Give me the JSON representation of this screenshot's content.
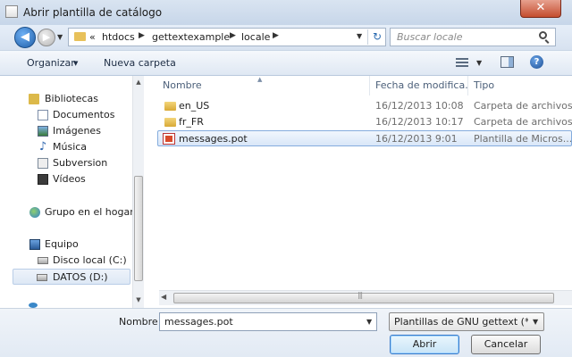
{
  "window": {
    "title": "Abrir plantilla de catálogo"
  },
  "navigation": {
    "back_glyph": "◀",
    "forward_glyph": "▶",
    "breadcrumb": [
      "htdocs",
      "gettextexample",
      "locale"
    ],
    "overflow": "«",
    "search_placeholder": "Buscar locale"
  },
  "toolbar": {
    "organize_label": "Organizar",
    "new_folder_label": "Nueva carpeta",
    "help_label": "?"
  },
  "sidebar": {
    "items": [
      {
        "label": "Bibliotecas",
        "icon": "library-icon"
      },
      {
        "label": "Documentos",
        "icon": "documents-icon"
      },
      {
        "label": "Imágenes",
        "icon": "pictures-icon"
      },
      {
        "label": "Música",
        "icon": "music-icon"
      },
      {
        "label": "Subversion",
        "icon": "subversion-icon"
      },
      {
        "label": "Vídeos",
        "icon": "videos-icon"
      },
      {
        "label": "Grupo en el hogar",
        "icon": "homegroup-icon"
      },
      {
        "label": "Equipo",
        "icon": "computer-icon"
      },
      {
        "label": "Disco local (C:)",
        "icon": "local-disk-icon"
      },
      {
        "label": "DATOS (D:)",
        "icon": "drive-icon"
      }
    ]
  },
  "file_list": {
    "columns": [
      "Nombre",
      "Fecha de modifica...",
      "Tipo"
    ],
    "rows": [
      {
        "name": "en_US",
        "date": "16/12/2013 10:08",
        "type": "Carpeta de archivos",
        "icon": "folder-icon"
      },
      {
        "name": "fr_FR",
        "date": "16/12/2013 10:17",
        "type": "Carpeta de archivos",
        "icon": "folder-icon"
      },
      {
        "name": "messages.pot",
        "date": "16/12/2013 9:01",
        "type": "Plantilla de Micros...",
        "icon": "pot-file-icon"
      }
    ]
  },
  "footer": {
    "name_label": "Nombre:",
    "file_name": "messages.pot",
    "filter": "Plantillas de GNU gettext (*.pot)",
    "open_label": "Abrir",
    "cancel_label": "Cancelar"
  },
  "colors": {
    "accent": "#3b7bc8",
    "selection": "#d9e7f8",
    "close": "#c44d2f"
  }
}
